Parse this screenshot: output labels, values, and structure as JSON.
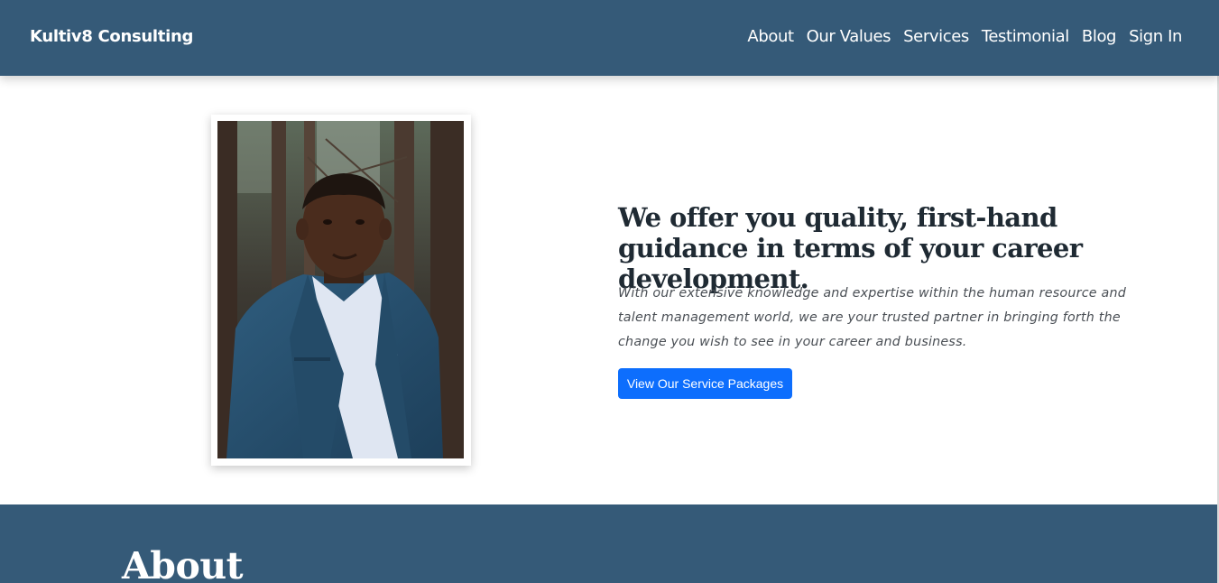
{
  "navbar": {
    "brand": "Kultiv8 Consulting",
    "links": [
      "About",
      "Our Values",
      "Services",
      "Testimonial",
      "Blog",
      "Sign In"
    ],
    "background": "#355a78"
  },
  "hero": {
    "headline": "We offer you quality, first-hand guidance in terms of your career development.",
    "lead": "With our extensive knowledge and expertise within the human resource and talent management world, we are your trusted partner in bringing forth the change you wish to see in your career and business.",
    "cta_label": "View Our Service Packages",
    "cta_color": "#0d6efd"
  },
  "about": {
    "title": "About"
  }
}
